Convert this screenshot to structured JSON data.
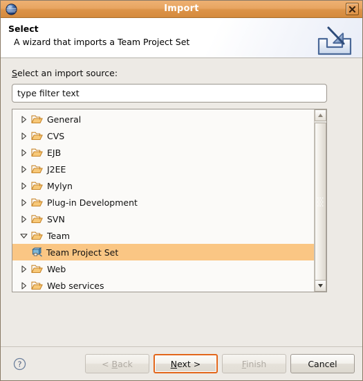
{
  "window": {
    "title": "Import",
    "app_icon": "eclipse-sphere-icon",
    "close_icon": "close-icon"
  },
  "header": {
    "title": "Select",
    "description": "A wizard that imports a Team Project Set",
    "icon": "import-arrow-icon"
  },
  "form": {
    "label": "Select an import source:",
    "label_mnemonic": "S",
    "label_rest": "elect an import source:",
    "filter": {
      "value": "type filter text",
      "placeholder": "type filter text"
    }
  },
  "tree": {
    "items": [
      {
        "label": "General",
        "icon": "folder-icon",
        "expander": "collapsed",
        "level": 0,
        "selected": false
      },
      {
        "label": "CVS",
        "icon": "folder-icon",
        "expander": "collapsed",
        "level": 0,
        "selected": false
      },
      {
        "label": "EJB",
        "icon": "folder-icon",
        "expander": "collapsed",
        "level": 0,
        "selected": false
      },
      {
        "label": "J2EE",
        "icon": "folder-icon",
        "expander": "collapsed",
        "level": 0,
        "selected": false
      },
      {
        "label": "Mylyn",
        "icon": "folder-icon",
        "expander": "collapsed",
        "level": 0,
        "selected": false
      },
      {
        "label": "Plug-in Development",
        "icon": "folder-icon",
        "expander": "collapsed",
        "level": 0,
        "selected": false
      },
      {
        "label": "SVN",
        "icon": "folder-icon",
        "expander": "collapsed",
        "level": 0,
        "selected": false
      },
      {
        "label": "Team",
        "icon": "folder-icon",
        "expander": "expanded",
        "level": 0,
        "selected": false
      },
      {
        "label": "Team Project Set",
        "icon": "team-project-set-icon",
        "expander": "none",
        "level": 1,
        "selected": true
      },
      {
        "label": "Web",
        "icon": "folder-icon",
        "expander": "collapsed",
        "level": 0,
        "selected": false
      },
      {
        "label": "Web services",
        "icon": "folder-icon",
        "expander": "collapsed",
        "level": 0,
        "selected": false
      }
    ],
    "scrollbar": {
      "up_icon": "scroll-up-icon",
      "down_icon": "scroll-down-icon"
    }
  },
  "footer": {
    "help_icon": "help-question-icon",
    "buttons": [
      {
        "label": "< Back",
        "mnemonic": "B",
        "enabled": false,
        "focused": false
      },
      {
        "label": "Next >",
        "mnemonic": "N",
        "enabled": true,
        "focused": true
      },
      {
        "label": "Finish",
        "mnemonic": "F",
        "enabled": false,
        "focused": false
      },
      {
        "label": "Cancel",
        "mnemonic": "",
        "enabled": true,
        "focused": false
      }
    ]
  },
  "colors": {
    "titlebar_top": "#eeb173",
    "titlebar_bottom": "#d48a3c",
    "dialog_bg": "#edeae5",
    "tree_bg": "#fbfaf8",
    "selection": "#fac684",
    "focus_ring": "#e2661a",
    "folder": "#f0b757"
  }
}
